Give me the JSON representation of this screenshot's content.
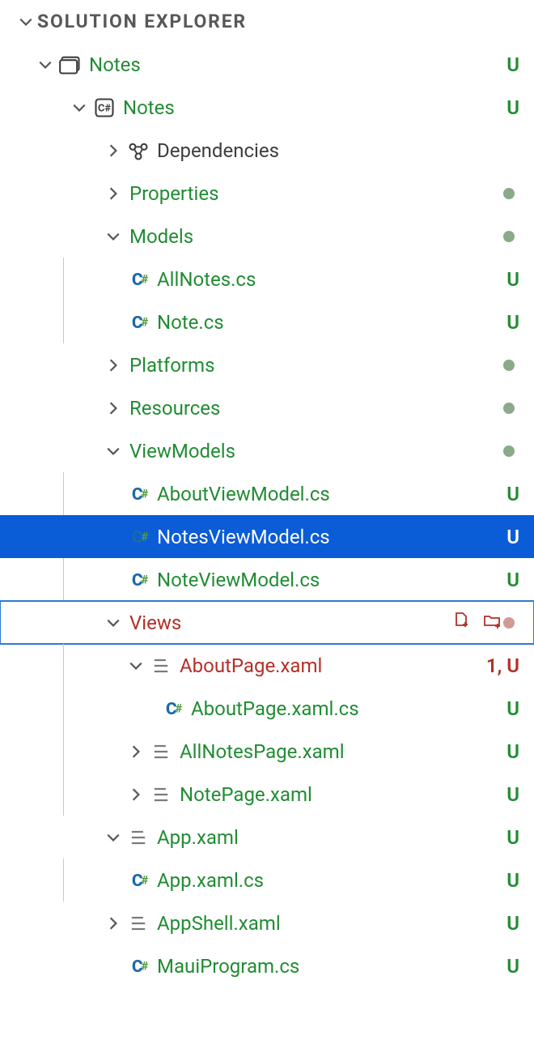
{
  "panel": {
    "title": "SOLUTION EXPLORER"
  },
  "status": {
    "U": "U",
    "oneU": "1, U"
  },
  "tree": {
    "sln": {
      "label": "Notes"
    },
    "proj": {
      "label": "Notes"
    },
    "dependencies": {
      "label": "Dependencies"
    },
    "properties": {
      "label": "Properties"
    },
    "models": {
      "label": "Models"
    },
    "allnotes": {
      "label": "AllNotes.cs"
    },
    "note": {
      "label": "Note.cs"
    },
    "platforms": {
      "label": "Platforms"
    },
    "resources": {
      "label": "Resources"
    },
    "viewmodels": {
      "label": "ViewModels"
    },
    "aboutvm": {
      "label": "AboutViewModel.cs"
    },
    "notesvm": {
      "label": "NotesViewModel.cs"
    },
    "notevm": {
      "label": "NoteViewModel.cs"
    },
    "views": {
      "label": "Views"
    },
    "aboutpage": {
      "label": "AboutPage.xaml"
    },
    "aboutpagecs": {
      "label": "AboutPage.xaml.cs"
    },
    "allnotespage": {
      "label": "AllNotesPage.xaml"
    },
    "notepage": {
      "label": "NotePage.xaml"
    },
    "app": {
      "label": "App.xaml"
    },
    "appcs": {
      "label": "App.xaml.cs"
    },
    "appshell": {
      "label": "AppShell.xaml"
    },
    "mauiprogram": {
      "label": "MauiProgram.cs"
    }
  }
}
